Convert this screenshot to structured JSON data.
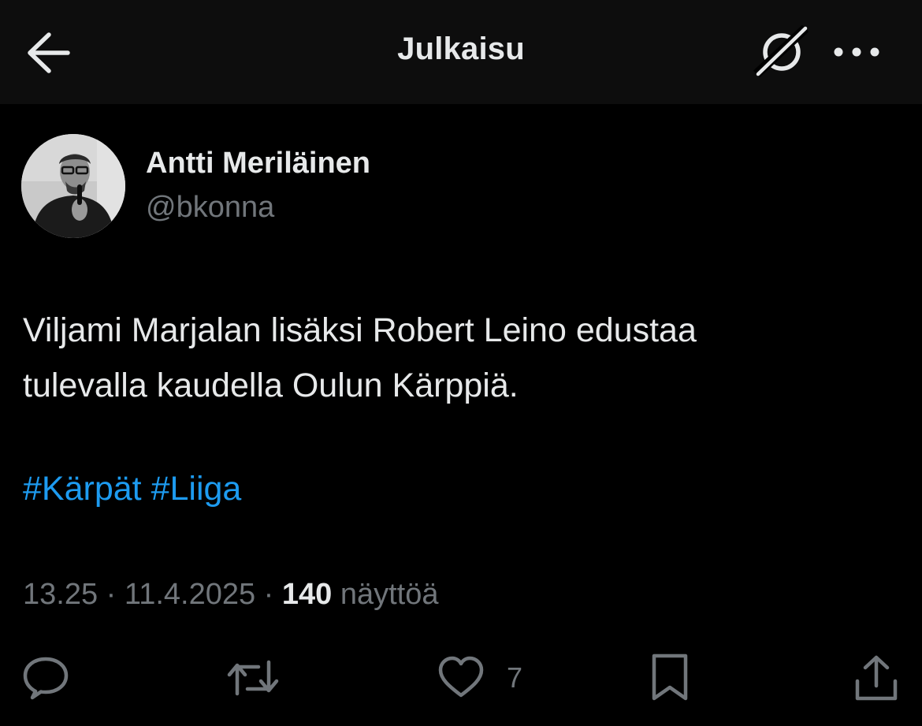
{
  "header": {
    "title": "Julkaisu",
    "back_icon": "arrow-left-icon",
    "grok_icon": "grok-icon",
    "more_icon": "more-horizontal-icon"
  },
  "author": {
    "name": "Antti Meriläinen",
    "handle": "@bkonna"
  },
  "post": {
    "lines": [
      "Viljami Marjalan lisäksi Robert Leino edustaa",
      "tulevalla kaudella Oulun Kärppiä."
    ],
    "hashtags": [
      "#Kärpät",
      "#Liiga"
    ]
  },
  "meta": {
    "time": "13.25",
    "separator1": " · ",
    "date": "11.4.2025",
    "separator2": " · ",
    "views_count": "140",
    "views_label": " näyttöä"
  },
  "actions": {
    "reply_icon": "reply-icon",
    "repost_icon": "repost-icon",
    "like_icon": "heart-icon",
    "like_count": "7",
    "bookmark_icon": "bookmark-icon",
    "share_icon": "share-icon"
  },
  "colors": {
    "background": "#000000",
    "header_bg": "#0d0d0d",
    "text_primary": "#e7e9ea",
    "text_secondary": "#71767b",
    "link": "#1d9bf0"
  }
}
